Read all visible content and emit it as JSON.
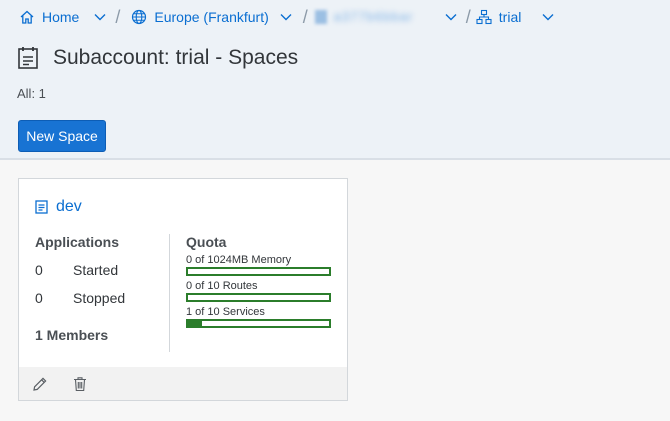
{
  "breadcrumb": {
    "home_label": "Home",
    "region_label": "Europe (Frankfurt)",
    "account_label": "a377b6bbar",
    "subaccount_label": "trial"
  },
  "header": {
    "title": "Subaccount: trial - Spaces",
    "count": "All: 1",
    "new_space_label": "New Space"
  },
  "space_card": {
    "name": "dev",
    "applications_heading": "Applications",
    "started_count": "0",
    "started_label": "Started",
    "stopped_count": "0",
    "stopped_label": "Stopped",
    "members_label": "1 Members",
    "quota_heading": "Quota",
    "quotas": [
      {
        "label": "0 of 1024MB Memory",
        "used": 0,
        "total": 1024
      },
      {
        "label": "0 of 10 Routes",
        "used": 0,
        "total": 10
      },
      {
        "label": "1 of 10 Services",
        "used": 1,
        "total": 10
      }
    ]
  },
  "colors": {
    "accent": "#0a6ed1",
    "button": "#1873d3",
    "quota_bar": "#2b7d2b",
    "header_bg": "#edf2f7"
  },
  "icons": [
    "home-icon",
    "globe-icon",
    "chevron-down-icon",
    "account-icon",
    "hierarchy-icon",
    "page-icon",
    "space-icon",
    "edit-icon",
    "delete-icon"
  ]
}
